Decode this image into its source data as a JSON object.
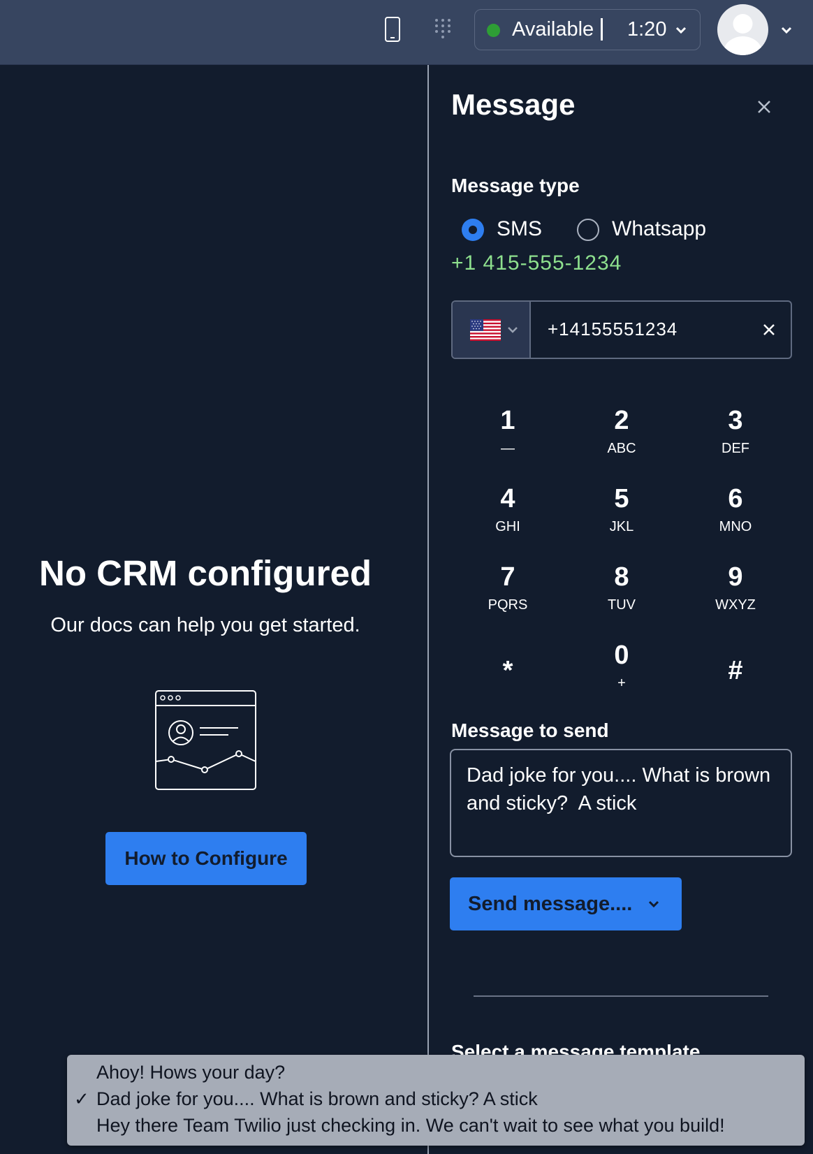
{
  "topbar": {
    "status_label": "Available",
    "timer": "1:20",
    "status_color": "#2e9e35",
    "icons": [
      "phone-icon",
      "dialpad-icon",
      "chevron-down-icon",
      "avatar-icon"
    ]
  },
  "left": {
    "title": "No CRM configured",
    "subtitle": "Our docs can help you get started.",
    "button_label": "How to Configure"
  },
  "panel": {
    "title": "Message",
    "message_type_label": "Message type",
    "options": [
      {
        "label": "SMS",
        "selected": true
      },
      {
        "label": "Whatsapp",
        "selected": false
      }
    ],
    "from_number": "+1 415-555-1234",
    "phone_input_value": "+14155551234",
    "country": "US",
    "keypad": [
      {
        "digit": "1",
        "sub": "—"
      },
      {
        "digit": "2",
        "sub": "ABC"
      },
      {
        "digit": "3",
        "sub": "DEF"
      },
      {
        "digit": "4",
        "sub": "GHI"
      },
      {
        "digit": "5",
        "sub": "JKL"
      },
      {
        "digit": "6",
        "sub": "MNO"
      },
      {
        "digit": "7",
        "sub": "PQRS"
      },
      {
        "digit": "8",
        "sub": "TUV"
      },
      {
        "digit": "9",
        "sub": "WXYZ"
      },
      {
        "digit": "*",
        "sub": ""
      },
      {
        "digit": "0",
        "sub": "+"
      },
      {
        "digit": "#",
        "sub": ""
      }
    ],
    "message_label": "Message to send",
    "message_value": "Dad joke for you.... What is brown and sticky?  A stick",
    "send_label": "Send message....",
    "template_label": "Select a message template"
  },
  "dropdown": {
    "options": [
      {
        "label": "Ahoy! Hows your day?",
        "checked": false
      },
      {
        "label": "Dad joke for you.... What is brown and sticky? A stick",
        "checked": true
      },
      {
        "label": "Hey there Team Twilio just checking in. We can't wait to see what you build!",
        "checked": false
      }
    ],
    "check_mark": "✓"
  },
  "colors": {
    "background": "#121c2d",
    "topbar": "#374560",
    "accent": "#2e7ef0",
    "phone_green": "#8ee08e"
  }
}
